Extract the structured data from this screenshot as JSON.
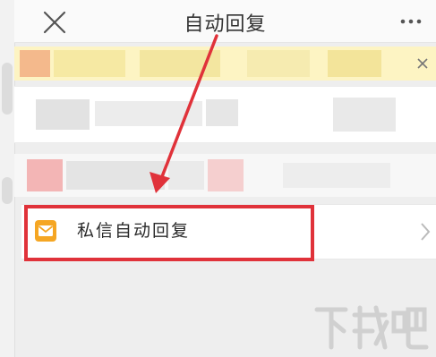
{
  "header": {
    "title": "自动回复",
    "close_icon": "close-icon",
    "more_icon": "more-icon"
  },
  "banner": {
    "close_icon": "close-icon"
  },
  "menu": {
    "auto_reply_item": {
      "label": "私信自动回复",
      "icon": "envelope-icon",
      "chevron": "chevron-right-icon"
    }
  },
  "annotation": {
    "highlight_color": "#e0323a"
  },
  "watermark": {
    "text": "下载吧"
  },
  "colors": {
    "banner_bg": "#fdf4c3",
    "icon_orange": "#f5a623",
    "annotation_red": "#e0323a"
  }
}
